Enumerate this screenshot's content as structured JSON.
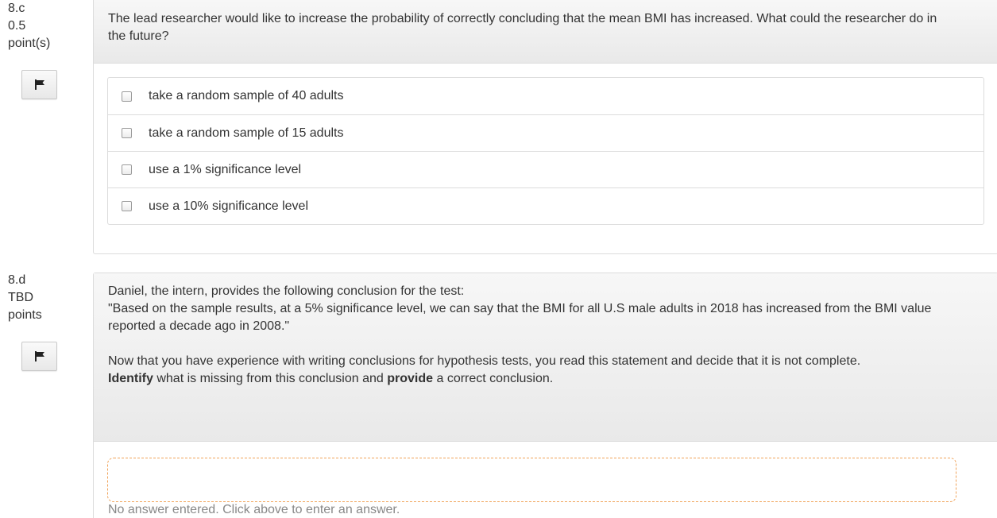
{
  "q8c": {
    "number": "8.c",
    "points": "0.5",
    "points_unit": "point(s)",
    "prompt": "The lead researcher would like to increase the probability of correctly concluding that the mean BMI has increased. What could the researcher do in the future?",
    "choices": [
      {
        "label": "take a random sample of 40 adults",
        "checked": false
      },
      {
        "label": "take a random sample of 15 adults",
        "checked": false
      },
      {
        "label": "use a 1% significance level",
        "checked": false
      },
      {
        "label": "use a 10% significance level",
        "checked": false
      }
    ],
    "flag_icon": "flag-icon"
  },
  "q8d": {
    "number": "8.d",
    "points": "TBD",
    "points_unit": "points",
    "prompt_intro": "Daniel, the intern, provides the following conclusion for the test:",
    "prompt_quote": "\"Based on the sample results, at a 5% significance level, we can say that the BMI for all U.S male adults in 2018 has increased from the BMI value reported a decade ago in 2008.\"",
    "prompt_line3": "Now that you have experience with writing conclusions for hypothesis tests, you read this statement and decide that it is not complete.",
    "prompt_bold1": "Identify",
    "prompt_mid": " what is missing from this conclusion and ",
    "prompt_bold2": "provide",
    "prompt_end": " a correct conclusion.",
    "answer_value": "",
    "answer_note": "No answer entered. Click above to enter an answer.",
    "flag_icon": "flag-icon"
  },
  "colors": {
    "answer_border": "#f0a35a",
    "prompt_bg": "#eeeeee",
    "note_text": "#888888"
  }
}
